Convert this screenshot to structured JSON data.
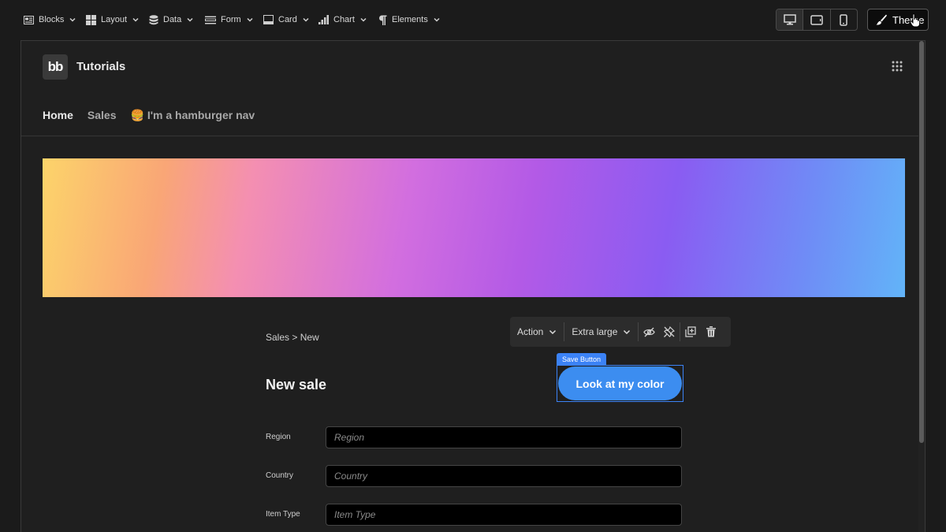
{
  "toolbar": {
    "items": [
      {
        "label": "Blocks",
        "icon": "blocks-icon"
      },
      {
        "label": "Layout",
        "icon": "layout-icon"
      },
      {
        "label": "Data",
        "icon": "database-icon"
      },
      {
        "label": "Form",
        "icon": "form-icon"
      },
      {
        "label": "Card",
        "icon": "card-icon"
      },
      {
        "label": "Chart",
        "icon": "chart-icon"
      },
      {
        "label": "Elements",
        "icon": "paragraph-icon"
      }
    ],
    "devices": [
      "desktop-icon",
      "tablet-icon",
      "mobile-icon"
    ],
    "theme_label": "Theme"
  },
  "app": {
    "logo_text": "bb",
    "title": "Tutorials",
    "nav": [
      "Home",
      "Sales",
      "🍔 I'm a hamburger nav"
    ]
  },
  "page": {
    "breadcrumb": "Sales > New",
    "title": "New sale"
  },
  "settings_bar": {
    "action_label": "Action",
    "size_label": "Extra large"
  },
  "selected_component": {
    "tag": "Save Button",
    "button_label": "Look at my color"
  },
  "form": {
    "fields": [
      {
        "label": "Region",
        "placeholder": "Region"
      },
      {
        "label": "Country",
        "placeholder": "Country"
      },
      {
        "label": "Item Type",
        "placeholder": "Item Type"
      }
    ]
  },
  "colors": {
    "accent": "#3b82f6",
    "button": "#3c8df0",
    "background": "#1b1b1b"
  }
}
